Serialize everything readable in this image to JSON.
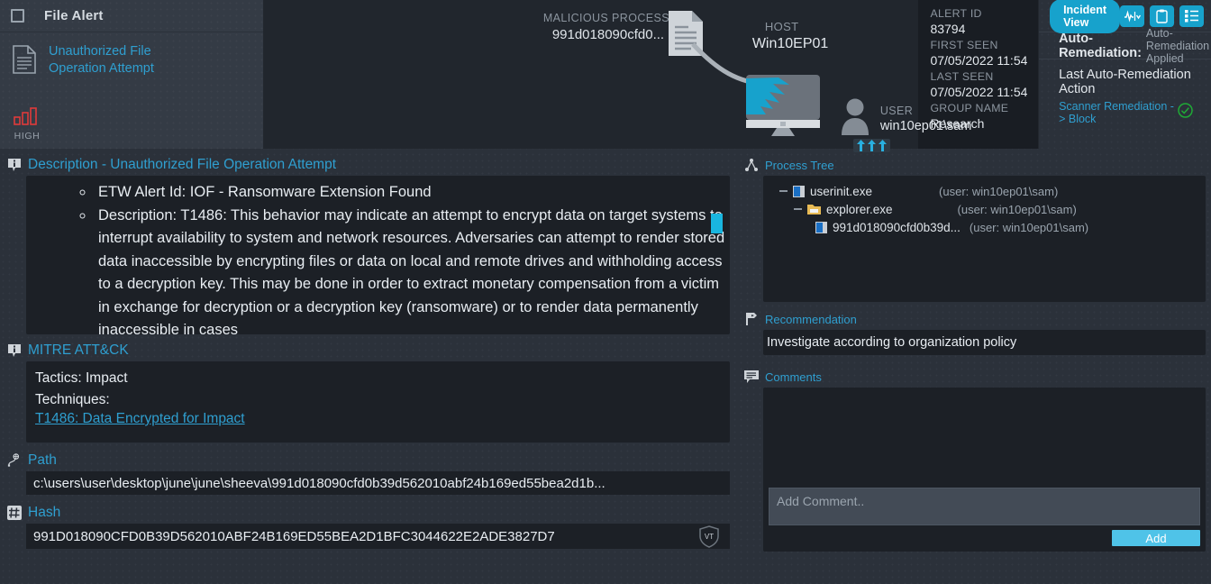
{
  "alert_card": {
    "title": "File Alert",
    "link_line1": "Unauthorized File",
    "link_line2": "Operation Attempt",
    "severity": "HIGH",
    "severity_color": "#e03a3a",
    "doc_icon": "document-icon",
    "severity_icon": "signal-bars-icon"
  },
  "topology": {
    "malicious_process_label": "MALICIOUS PROCESS",
    "malicious_process_value": "991d018090cfd0...",
    "host_label": "HOST",
    "host_value": "Win10EP01",
    "user_label": "USER",
    "user_value": "win10ep01\\sam",
    "arrows": "↑↑↑"
  },
  "meta": [
    {
      "key": "ALERT ID",
      "value": "83794"
    },
    {
      "key": "FIRST SEEN",
      "value": "07/05/2022 11:54"
    },
    {
      "key": "LAST SEEN",
      "value": "07/05/2022 11:54"
    },
    {
      "key": "GROUP NAME",
      "value": "Research"
    }
  ],
  "remediation": {
    "view_toggle": "Incident View",
    "icons": [
      "activity-chevron-icon",
      "clipboard-icon",
      "list-icon"
    ],
    "auto_remediation_label": "Auto-Remediation:",
    "auto_remediation_status": "Auto-Remediation Applied",
    "last_action_title": "Last Auto-Remediation Action",
    "last_action_value": "Scanner Remediation -> Block",
    "status_icon": "check-circle-icon",
    "status_color": "#1faa36"
  },
  "description": {
    "heading": "Description - Unauthorized File Operation Attempt",
    "items": [
      "ETW Alert Id: IOF - Ransomware Extension Found",
      "Description: T1486: This behavior may indicate an attempt to encrypt data on target systems to interrupt availability to system and network resources. Adversaries can attempt to render stored data inaccessible by encrypting files or data on local and remote drives and withholding access to a decryption key. This may be done in order to extract monetary compensation from a victim in exchange for decryption or a decryption key (ransomware) or to render data permanently inaccessible in cases"
    ]
  },
  "mitre": {
    "heading": "MITRE ATT&CK",
    "tactics": "Tactics: Impact",
    "techniques_label": "Techniques:",
    "technique_link": "T1486: Data Encrypted for Impact"
  },
  "path": {
    "heading": "Path",
    "value": "c:\\users\\user\\desktop\\june\\june\\sheeva\\991d018090cfd0b39d562010abf24b169ed55bea2d1b..."
  },
  "hash": {
    "heading": "Hash",
    "value": "991D018090CFD0B39D562010ABF24B169ED55BEA2D1BFC3044622E2ADE3827D7",
    "vt_icon": "virustotal-shield-icon",
    "vt_label": "VT"
  },
  "process_tree": {
    "heading": "Process Tree",
    "nodes": [
      {
        "name": "userinit.exe",
        "user": "(user: win10ep01\\sam)",
        "depth": 0,
        "icon": "exe-icon",
        "expander": "minus"
      },
      {
        "name": "explorer.exe",
        "user": "(user: win10ep01\\sam)",
        "depth": 1,
        "icon": "folder-icon",
        "expander": "minus"
      },
      {
        "name": "991d018090cfd0b39d...",
        "user": "(user: win10ep01\\sam)",
        "depth": 2,
        "icon": "exe-icon",
        "expander": "none"
      }
    ]
  },
  "recommendation": {
    "heading": "Recommendation",
    "value": "Investigate according to organization policy"
  },
  "comments": {
    "heading": "Comments",
    "input_value": "",
    "placeholder": "Add Comment..",
    "add_label": "Add"
  },
  "colors": {
    "accent": "#2f9fd0",
    "pill": "#17a2cc",
    "add_button": "#4fc3e8",
    "panel": "#1c2026",
    "background": "#2b313a"
  }
}
